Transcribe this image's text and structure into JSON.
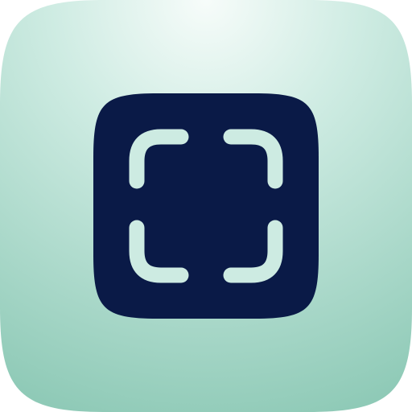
{
  "icon": {
    "name": "screenshot-frame-icon",
    "colors": {
      "background_light": "#f7fcfa",
      "background_mid": "#cfece3",
      "background_dark": "#8fcab7",
      "tile": "#0a1a47",
      "corner_marks": "#cdebe2"
    }
  }
}
